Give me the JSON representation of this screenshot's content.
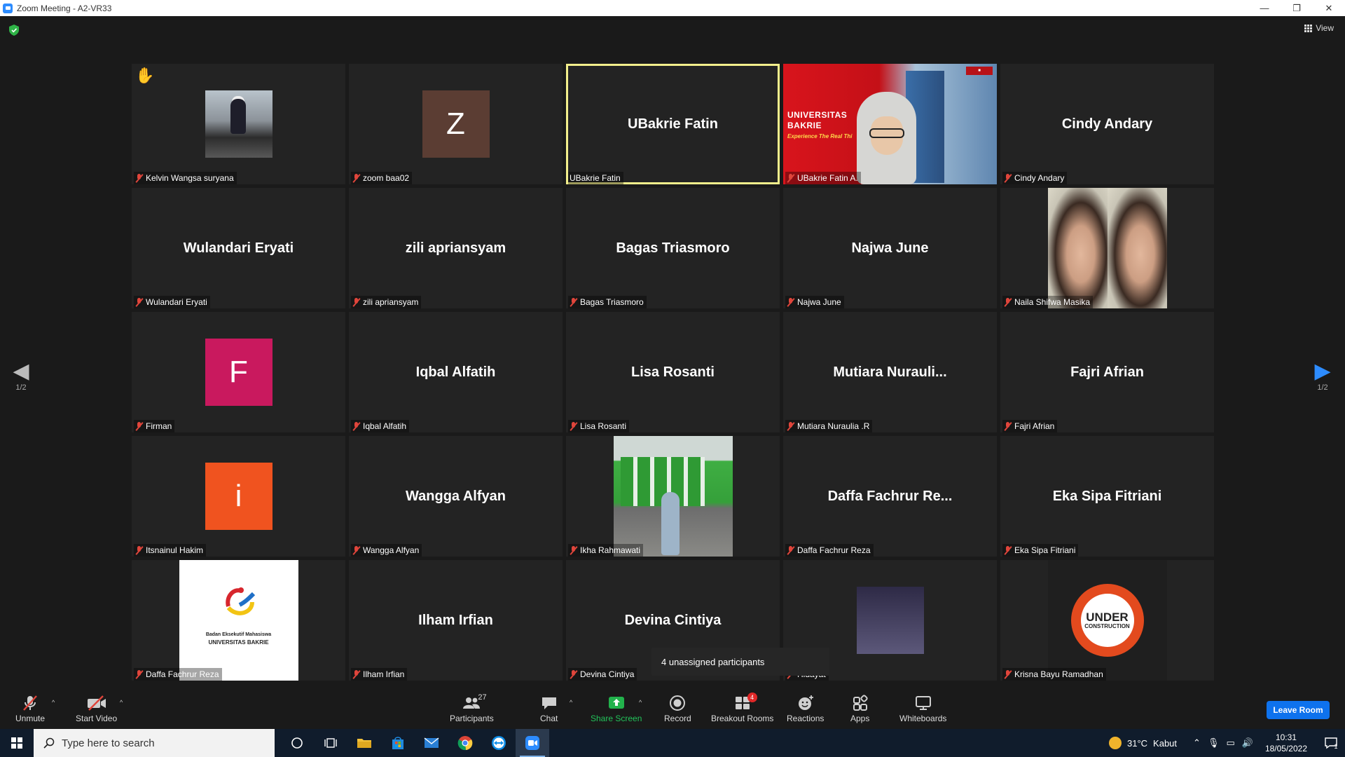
{
  "window": {
    "title": "Zoom Meeting - A2-VR33",
    "minimize": "—",
    "restore": "❐",
    "close": "✕"
  },
  "view_button": {
    "label": "View"
  },
  "pager": {
    "left_label": "1/2",
    "right_label": "1/2"
  },
  "tiles": [
    {
      "label": "Kelvin Wangsa suryana",
      "kind": "photo",
      "hand_raised": true
    },
    {
      "label": "zoom baa02",
      "kind": "avatar",
      "initial": "Z",
      "color": "#5b3d33"
    },
    {
      "label": "UBakrie Fatin",
      "kind": "name",
      "big_name": "UBakrie Fatin",
      "active_speaker": true,
      "muted": false
    },
    {
      "label": "UBakrie Fatin A.",
      "kind": "video",
      "video_text_1": "UNIVERSITAS",
      "video_text_2": "BAKRIE",
      "video_tagline": "Experience The Real Thi"
    },
    {
      "label": "Cindy Andary",
      "kind": "name",
      "big_name": "Cindy Andary"
    },
    {
      "label": "Wulandari Eryati",
      "kind": "name",
      "big_name": "Wulandari Eryati"
    },
    {
      "label": "zili apriansyam",
      "kind": "name",
      "big_name": "zili apriansyam"
    },
    {
      "label": "Bagas Triasmoro",
      "kind": "name",
      "big_name": "Bagas Triasmoro"
    },
    {
      "label": "Najwa June",
      "kind": "name",
      "big_name": "Najwa June"
    },
    {
      "label": "Naila Shifwa Masika",
      "kind": "photo"
    },
    {
      "label": "Firman",
      "kind": "avatar",
      "initial": "F",
      "color": "#c9195e"
    },
    {
      "label": "Iqbal Alfatih",
      "kind": "name",
      "big_name": "Iqbal Alfatih"
    },
    {
      "label": "Lisa Rosanti",
      "kind": "name",
      "big_name": "Lisa Rosanti"
    },
    {
      "label": "Mutiara Nuraulia .R",
      "kind": "name",
      "big_name": "Mutiara  Nurauli..."
    },
    {
      "label": "Fajri Afrian",
      "kind": "name",
      "big_name": "Fajri Afrian"
    },
    {
      "label": "Itsnainul Hakim",
      "kind": "avatar",
      "initial": "i",
      "color": "#f0531f"
    },
    {
      "label": "Wangga Alfyan",
      "kind": "name",
      "big_name": "Wangga Alfyan"
    },
    {
      "label": "Ikha Rahmawati",
      "kind": "photo"
    },
    {
      "label": "Daffa Fachrur Reza",
      "kind": "name",
      "big_name": "Daffa  Fachrur  Re..."
    },
    {
      "label": "Eka Sipa Fitriani",
      "kind": "name",
      "big_name": "Eka Sipa Fitriani"
    },
    {
      "label": "Daffa Fachrur Reza",
      "kind": "logo",
      "logo_line_1": "Badan Eksekutif Mahasiswa",
      "logo_line_2": "UNIVERSITAS BAKRIE"
    },
    {
      "label": "Ilham Irfian",
      "kind": "name",
      "big_name": "Ilham Irfian"
    },
    {
      "label": "Devina Cintiya",
      "kind": "name",
      "big_name": "Devina Cintiya"
    },
    {
      "label": "Hidayat",
      "kind": "photo"
    },
    {
      "label": "Krisna Bayu Ramadhan",
      "kind": "logo",
      "logo_line_1": "UNDER",
      "logo_line_2": "CONSTRUCTION"
    }
  ],
  "popover": {
    "text": "4 unassigned participants"
  },
  "toolbar": {
    "unmute": "Unmute",
    "start_video": "Start Video",
    "participants": "Participants",
    "participants_count": "27",
    "chat": "Chat",
    "share_screen": "Share Screen",
    "record": "Record",
    "breakout_rooms": "Breakout Rooms",
    "breakout_badge": "4",
    "reactions": "Reactions",
    "apps": "Apps",
    "whiteboards": "Whiteboards",
    "leave": "Leave Room"
  },
  "taskbar": {
    "search_placeholder": "Type here to search",
    "weather_temp": "31°C",
    "weather_text": "Kabut",
    "time": "10:31",
    "date": "18/05/2022",
    "notification_count": "1"
  },
  "colors": {
    "accent": "#2d8cff",
    "leave": "#0e72ed",
    "share": "#22b24c",
    "active_speaker": "#f3ef8c",
    "muted": "#e0453b"
  }
}
